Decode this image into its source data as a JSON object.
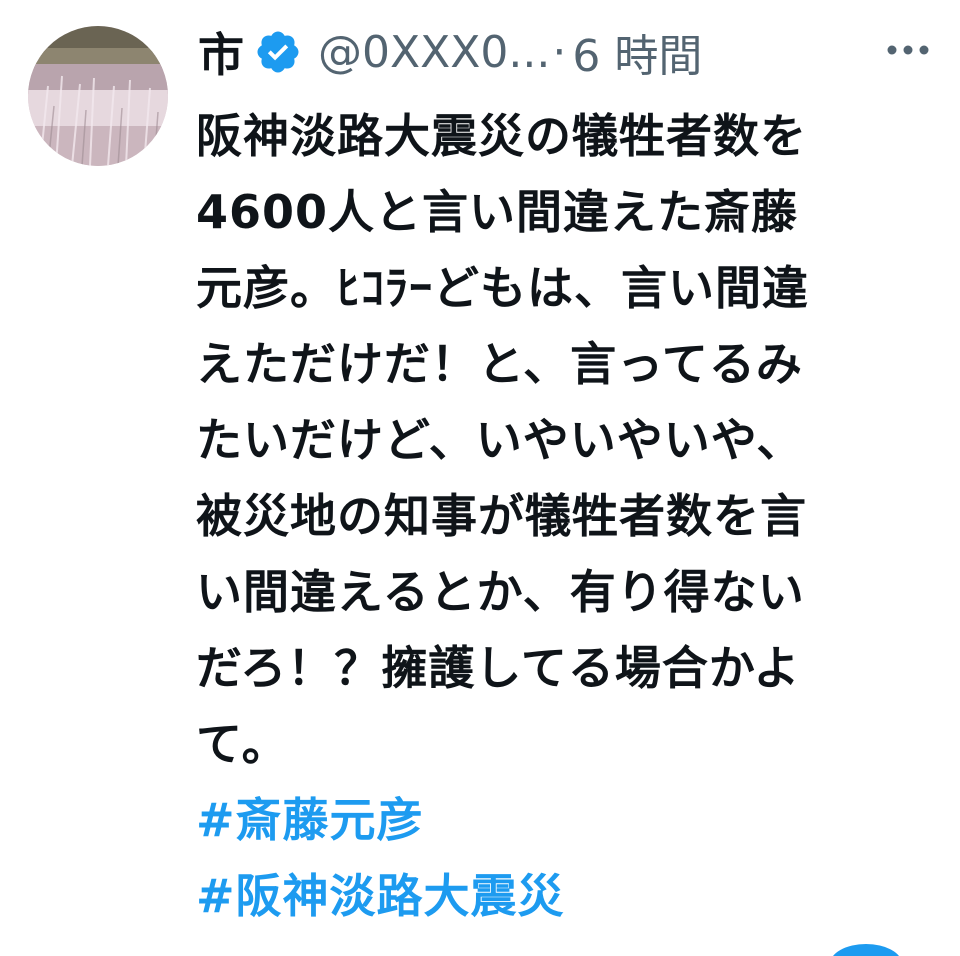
{
  "user": {
    "display_name": "市",
    "handle": "@0XXX0...",
    "separator": "·",
    "time": "6 時間"
  },
  "tweet": {
    "lines": [
      "阪神淡路大震災の犠牲者数を",
      "4600人と言い間違えた斎藤",
      "元彦。ﾋｺﾗｰどもは、言い間違",
      "えただけだ！と、言ってるみ",
      "たいだけど、いやいやいや、",
      "被災地の知事が犠牲者数を言",
      "い間違えるとか、有り得ない",
      "だろ！？擁護してる場合かよ",
      "て。"
    ],
    "hashtags": [
      "#斎藤元彦",
      "#阪神淡路大震災"
    ]
  },
  "icons": {
    "verified": "verified-badge-icon",
    "more": "more-options-icon"
  },
  "colors": {
    "text": "#0f1419",
    "secondary": "#536471",
    "accent": "#1d9bf0"
  }
}
